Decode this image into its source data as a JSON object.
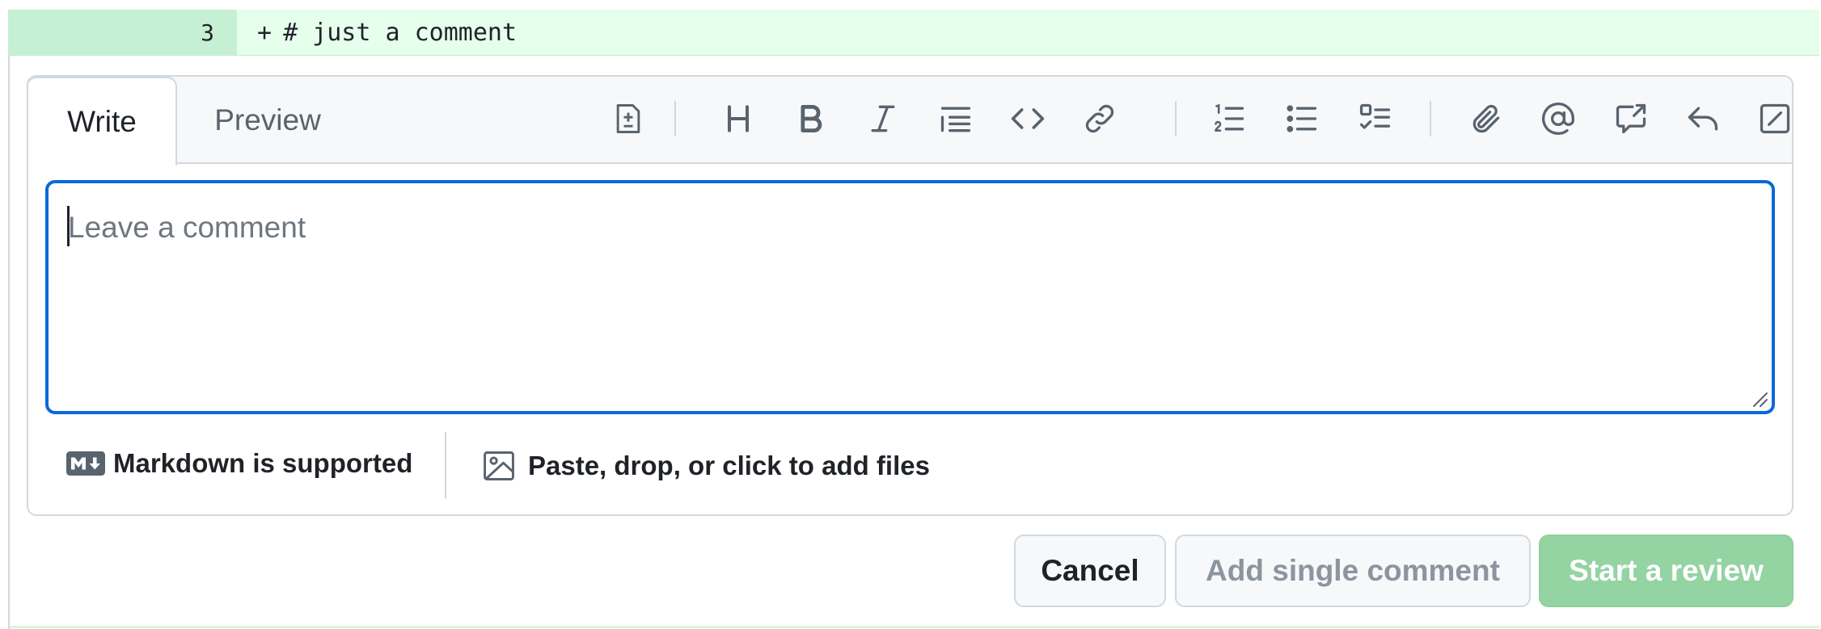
{
  "diff": {
    "line_number": "3",
    "marker": "+",
    "code": "# just a comment"
  },
  "tabs": {
    "write": "Write",
    "preview": "Preview"
  },
  "toolbar": {
    "tools": [
      {
        "name": "add-suggestion-icon"
      },
      {
        "name": "heading-icon"
      },
      {
        "name": "bold-icon"
      },
      {
        "name": "italic-icon"
      },
      {
        "name": "quote-icon"
      },
      {
        "name": "code-icon"
      },
      {
        "name": "link-icon"
      },
      {
        "name": "ordered-list-icon"
      },
      {
        "name": "unordered-list-icon"
      },
      {
        "name": "task-list-icon"
      },
      {
        "name": "attach-icon"
      },
      {
        "name": "mention-icon"
      },
      {
        "name": "cross-reference-icon"
      },
      {
        "name": "reply-icon"
      },
      {
        "name": "slash-commands-icon"
      }
    ]
  },
  "editor": {
    "placeholder": "Leave a comment"
  },
  "footer": {
    "markdown_label": "Markdown is supported",
    "files_label": "Paste, drop, or click to add files"
  },
  "actions": {
    "cancel": "Cancel",
    "add_single": "Add single comment",
    "start_review": "Start a review"
  },
  "colors": {
    "focus_border": "#0969da",
    "diff_added_bg": "#e6ffec",
    "diff_num_bg": "#c6f0d3",
    "primary_disabled": "#94d3a2"
  }
}
